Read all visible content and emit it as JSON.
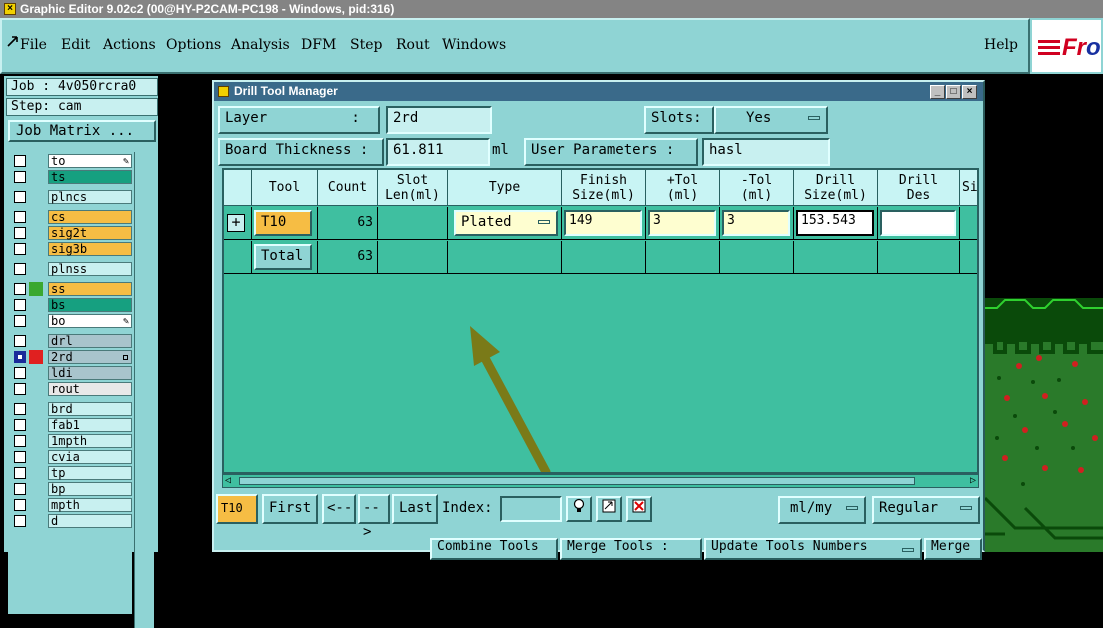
{
  "window": {
    "title": "Graphic Editor 9.02c2 (00@HY-P2CAM-PC198 - Windows, pid:316)"
  },
  "menu": {
    "items": [
      "File",
      "Edit",
      "Actions",
      "Options",
      "Analysis",
      "DFM",
      "Step",
      "Rout",
      "Windows"
    ],
    "help": "Help"
  },
  "logo": {
    "text_red": "Fr",
    "text_blue": "o"
  },
  "left": {
    "job": "Job : 4v050rcra0",
    "step": "Step: cam",
    "job_matrix": "Job Matrix ...",
    "layers": [
      {
        "name": "to",
        "color": "#ffffff",
        "swatch": "",
        "marker": "pencil"
      },
      {
        "name": "ts",
        "color": "#16a080",
        "swatch": "",
        "marker": ""
      },
      {
        "name": "plncs",
        "color": "#c8f0f0",
        "swatch": "",
        "marker": ""
      },
      {
        "name": "cs",
        "color": "#f6bd44",
        "swatch": "",
        "marker": ""
      },
      {
        "name": "sig2t",
        "color": "#f6bd44",
        "swatch": "",
        "marker": ""
      },
      {
        "name": "sig3b",
        "color": "#f6bd44",
        "swatch": "",
        "marker": ""
      },
      {
        "name": "plnss",
        "color": "#c8f0f0",
        "swatch": "",
        "marker": ""
      },
      {
        "name": "ss",
        "color": "#f6bd44",
        "swatch": "#3aa830",
        "marker": ""
      },
      {
        "name": "bs",
        "color": "#16a080",
        "swatch": "",
        "marker": ""
      },
      {
        "name": "bo",
        "color": "#ffffff",
        "swatch": "",
        "marker": "pencil"
      },
      {
        "name": "drl",
        "color": "#a8c4cc",
        "swatch": "",
        "marker": ""
      },
      {
        "name": "2rd",
        "color": "#a8c4cc",
        "swatch": "#e02020",
        "marker": "box",
        "checked": true
      },
      {
        "name": "ldi",
        "color": "#a8c4cc",
        "swatch": "",
        "marker": ""
      },
      {
        "name": "rout",
        "color": "#e8e8e8",
        "swatch": "",
        "marker": ""
      },
      {
        "name": "brd",
        "color": "#c8f0f0",
        "swatch": "",
        "marker": ""
      },
      {
        "name": "fab1",
        "color": "#c8f0f0",
        "swatch": "",
        "marker": ""
      },
      {
        "name": "1mpth",
        "color": "#c8f0f0",
        "swatch": "",
        "marker": ""
      },
      {
        "name": "cvia",
        "color": "#c8f0f0",
        "swatch": "",
        "marker": ""
      },
      {
        "name": "tp",
        "color": "#c8f0f0",
        "swatch": "",
        "marker": ""
      },
      {
        "name": "bp",
        "color": "#c8f0f0",
        "swatch": "",
        "marker": ""
      },
      {
        "name": "mpth",
        "color": "#c8f0f0",
        "swatch": "",
        "marker": ""
      },
      {
        "name": "d",
        "color": "#c8f0f0",
        "swatch": "",
        "marker": ""
      }
    ]
  },
  "dialog": {
    "title": "Drill Tool Manager",
    "layer_label": "Layer          :",
    "layer_value": "2rd",
    "slots_label": "Slots:",
    "slots_value": "Yes",
    "thickness_label": "Board Thickness :",
    "thickness_value": "61.811",
    "thickness_unit": "ml",
    "user_params_label": "User Parameters :",
    "user_params_value": "hasl",
    "columns": [
      "Tool",
      "Count",
      "Slot\nLen(ml)",
      "Type",
      "Finish\nSize(ml)",
      "+Tol\n(ml)",
      "-Tol\n(ml)",
      "Drill\nSize(ml)",
      "Drill\nDes",
      "Si"
    ],
    "rows": [
      {
        "tool": "T10",
        "count": "63",
        "slot": "",
        "type": "Plated",
        "finish": "149",
        "ptol": "3",
        "ntol": "3",
        "drill": "153.543",
        "des": ""
      },
      {
        "tool": "Total",
        "count": "63"
      }
    ],
    "bottom": {
      "current_tool": "T10",
      "first": "First",
      "prev": "<--",
      "next": "-->",
      "last": "Last",
      "index_label": "Index:",
      "index_value": "",
      "units": "ml/my",
      "mode": "Regular",
      "combine": "Combine Tools",
      "merge_tools": "Merge Tools :",
      "update_numbers": "Update Tools Numbers",
      "merge": "Merge"
    }
  },
  "colors": {
    "panel": "#8fd4d4",
    "grid_bg": "#3fbfa0",
    "tool_orange": "#f6bd44",
    "arrow": "#7a7a18"
  }
}
